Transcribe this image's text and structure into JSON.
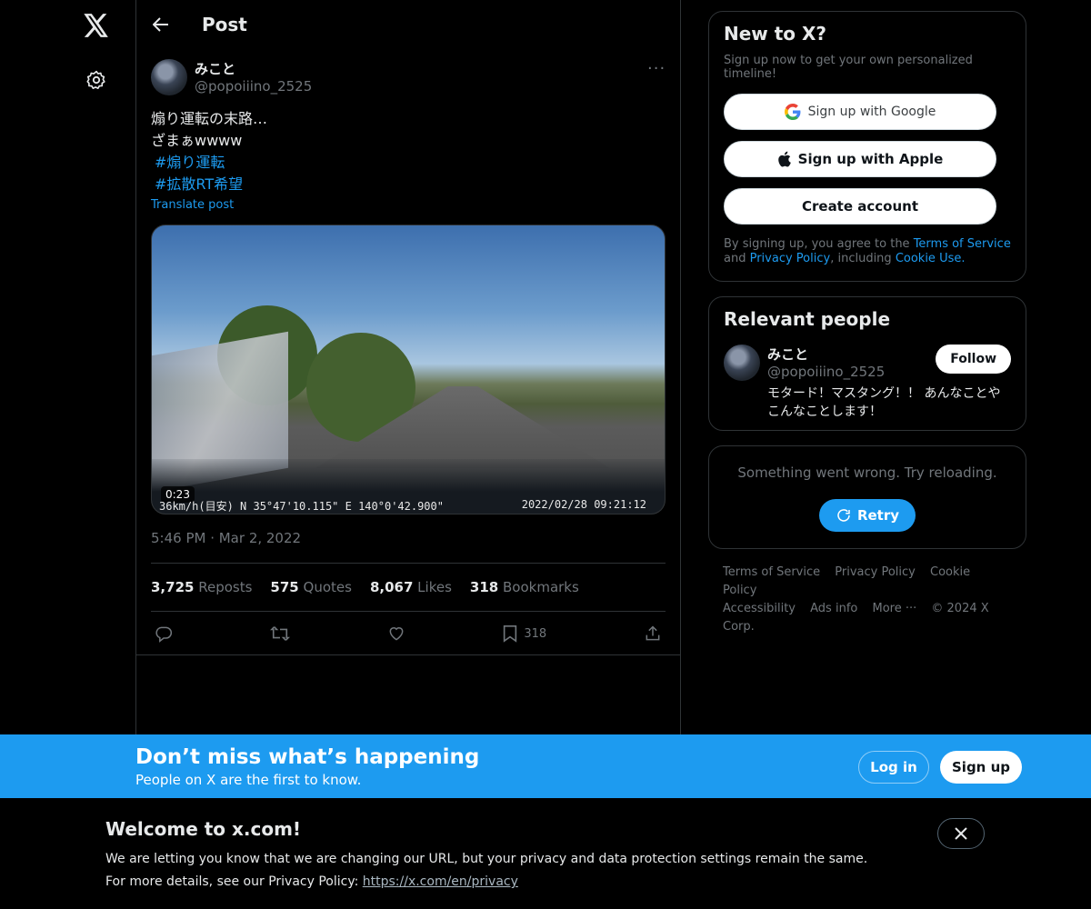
{
  "header": {
    "title": "Post"
  },
  "post": {
    "author_name": "みこと",
    "author_handle": "@popoiiino_2525",
    "text_line1": "煽り運転の末路…",
    "text_line2": "ざまぁwwww",
    "hashtag1": "#煽り運転",
    "hashtag2": "#拡散RT希望",
    "translate": "Translate post",
    "video_duration": "0:23",
    "video_overlay_speed": "36km/h(目安)  N 35°47'10.115\"  E 140°0'42.900\"",
    "video_overlay_time": "2022/02/28 09:21:12",
    "timestamp": "5:46 PM · Mar 2, 2022",
    "stats": {
      "reposts_count": "3,725",
      "reposts_label": "Reposts",
      "quotes_count": "575",
      "quotes_label": "Quotes",
      "likes_count": "8,067",
      "likes_label": "Likes",
      "bookmarks_count": "318",
      "bookmarks_label": "Bookmarks"
    },
    "bookmark_action_count": "318"
  },
  "signup_card": {
    "title": "New to X?",
    "subtitle": "Sign up now to get your own personalized timeline!",
    "google": "Sign up with Google",
    "apple": "Sign up with Apple",
    "create": "Create account",
    "legal_prefix": "By signing up, you agree to the ",
    "terms": "Terms of Service",
    "legal_and": " and ",
    "privacy": "Privacy Policy",
    "legal_including": ", including ",
    "cookie": "Cookie Use."
  },
  "relevant": {
    "title": "Relevant people",
    "name": "みこと",
    "handle": "@popoiiino_2525",
    "follow": "Follow",
    "bio": "モタード！マスタング！！ あんなことやこんなことします！"
  },
  "error_card": {
    "message": "Something went wrong. Try reloading.",
    "retry": "Retry"
  },
  "footer": {
    "links": [
      "Terms of Service",
      "Privacy Policy",
      "Cookie Policy",
      "Accessibility",
      "Ads info",
      "More ···",
      "© 2024 X Corp."
    ]
  },
  "banner": {
    "headline": "Don’t miss what’s happening",
    "sub": "People on X are the first to know.",
    "login": "Log in",
    "signup": "Sign up"
  },
  "notice": {
    "title": "Welcome to x.com!",
    "line1": "We are letting you know that we are changing our URL, but your privacy and data protection settings remain the same.",
    "line2_prefix": "For more details, see our Privacy Policy: ",
    "line2_link": "https://x.com/en/privacy"
  },
  "colors": {
    "accent": "#1d9bf0",
    "background": "#000000",
    "border": "#2f3336",
    "muted": "#71767b"
  }
}
